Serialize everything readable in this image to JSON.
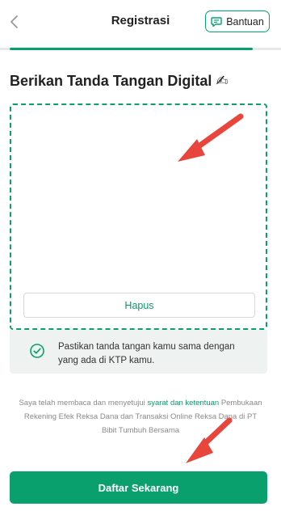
{
  "header": {
    "title": "Registrasi",
    "help_label": "Bantuan",
    "back_icon": "chevron-left-icon",
    "help_icon": "chat-bubble-icon"
  },
  "progress": {
    "fraction": 0.93
  },
  "page_title": "Berikan Tanda Tangan Digital",
  "page_title_emoji": "✍",
  "signature_pad": {
    "clear_label": "Hapus"
  },
  "hint": {
    "icon": "check-circle-icon",
    "text": "Pastikan tanda tangan kamu sama dengan yang ada di KTP kamu."
  },
  "terms": {
    "prefix": "Saya telah membaca dan menyetujui",
    "link_text": "syarat dan ketentuan",
    "suffix": "Pembukaan Rekening Efek Reksa Dana dan Transaksi Online Reksa Dana di PT Bibit Tumbuh Bersama"
  },
  "submit_label": "Daftar Sekarang",
  "colors": {
    "accent": "#0aa06e",
    "annotation_arrow": "#e8453c",
    "hint_background": "#eef2f0"
  }
}
